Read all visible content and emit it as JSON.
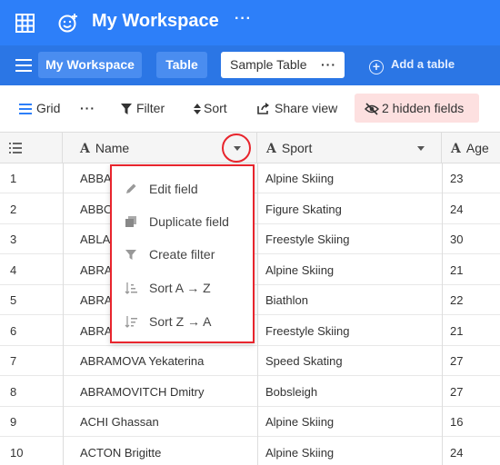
{
  "header": {
    "workspace_title": "My Workspace",
    "more_label": "···"
  },
  "tabs": {
    "items": [
      {
        "label": "My Workspace"
      },
      {
        "label": "Table"
      },
      {
        "label": "Sample Table",
        "more": "···"
      }
    ],
    "add_table_label": "Add a table"
  },
  "toolbar": {
    "grid_label": "Grid",
    "more_label": "···",
    "filter_label": "Filter",
    "sort_label": "Sort",
    "share_label": "Share view",
    "hidden_fields_label": "2 hidden fields"
  },
  "columns": {
    "name": "Name",
    "sport": "Sport",
    "age": "Age"
  },
  "rows": [
    {
      "n": "1",
      "name": "ABBA",
      "sport": "Alpine Skiing",
      "age": "23"
    },
    {
      "n": "2",
      "name": "ABBO",
      "sport": "Figure Skating",
      "age": "24"
    },
    {
      "n": "3",
      "name": "ABLA",
      "sport": "Freestyle Skiing",
      "age": "30"
    },
    {
      "n": "4",
      "name": "ABRA",
      "sport": "Alpine Skiing",
      "age": "21"
    },
    {
      "n": "5",
      "name": "ABRA",
      "sport": "Biathlon",
      "age": "22"
    },
    {
      "n": "6",
      "name": "ABRA",
      "sport": "Freestyle Skiing",
      "age": "21"
    },
    {
      "n": "7",
      "name": "ABRAMOVA Yekaterina",
      "sport": "Speed Skating",
      "age": "27"
    },
    {
      "n": "8",
      "name": "ABRAMOVITCH Dmitry",
      "sport": "Bobsleigh",
      "age": "27"
    },
    {
      "n": "9",
      "name": "ACHI Ghassan",
      "sport": "Alpine Skiing",
      "age": "16"
    },
    {
      "n": "10",
      "name": "ACTON Brigitte",
      "sport": "Alpine Skiing",
      "age": "24"
    }
  ],
  "field_menu": {
    "items": [
      {
        "label": "Edit field",
        "icon": "pencil-icon"
      },
      {
        "label": "Duplicate field",
        "icon": "duplicate-icon"
      },
      {
        "label": "Create filter",
        "icon": "filter-icon"
      },
      {
        "label": "Sort A → Z",
        "icon": "sort-asc-icon"
      },
      {
        "label": "Sort Z → A",
        "icon": "sort-desc-icon"
      }
    ]
  },
  "colors": {
    "brand_blue": "#2d7ff9",
    "highlight_red": "#e8252d",
    "hidden_fields_bg": "#fde0e0"
  }
}
